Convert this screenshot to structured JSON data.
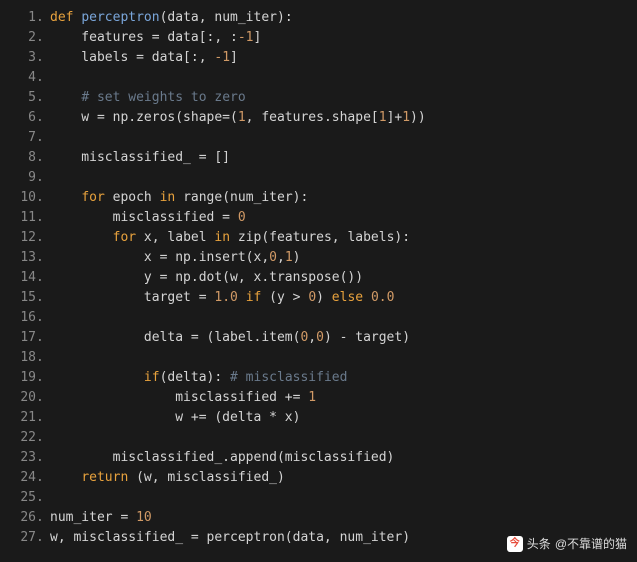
{
  "lines": [
    {
      "n": "1",
      "tokens": [
        [
          "kw",
          "def "
        ],
        [
          "fn",
          "perceptron"
        ],
        [
          "txt",
          "(data, num_iter):"
        ]
      ]
    },
    {
      "n": "2",
      "tokens": [
        [
          "txt",
          "    features = data[:, :"
        ],
        [
          "num",
          "-1"
        ],
        [
          "txt",
          "]"
        ]
      ]
    },
    {
      "n": "3",
      "tokens": [
        [
          "txt",
          "    labels = data[:, "
        ],
        [
          "num",
          "-1"
        ],
        [
          "txt",
          "]"
        ]
      ]
    },
    {
      "n": "4",
      "tokens": []
    },
    {
      "n": "5",
      "tokens": [
        [
          "txt",
          "    "
        ],
        [
          "cm",
          "# set weights to zero"
        ]
      ]
    },
    {
      "n": "6",
      "tokens": [
        [
          "txt",
          "    w = np.zeros(shape=("
        ],
        [
          "num",
          "1"
        ],
        [
          "txt",
          ", features.shape["
        ],
        [
          "num",
          "1"
        ],
        [
          "txt",
          "]+"
        ],
        [
          "num",
          "1"
        ],
        [
          "txt",
          "))"
        ]
      ]
    },
    {
      "n": "7",
      "tokens": []
    },
    {
      "n": "8",
      "tokens": [
        [
          "txt",
          "    misclassified_ = []"
        ]
      ]
    },
    {
      "n": "9",
      "tokens": []
    },
    {
      "n": "10",
      "tokens": [
        [
          "txt",
          "    "
        ],
        [
          "kw",
          "for"
        ],
        [
          "txt",
          " epoch "
        ],
        [
          "kw",
          "in"
        ],
        [
          "txt",
          " range(num_iter):"
        ]
      ]
    },
    {
      "n": "11",
      "tokens": [
        [
          "txt",
          "        misclassified = "
        ],
        [
          "num",
          "0"
        ]
      ]
    },
    {
      "n": "12",
      "tokens": [
        [
          "txt",
          "        "
        ],
        [
          "kw",
          "for"
        ],
        [
          "txt",
          " x, label "
        ],
        [
          "kw",
          "in"
        ],
        [
          "txt",
          " zip(features, labels):"
        ]
      ]
    },
    {
      "n": "13",
      "tokens": [
        [
          "txt",
          "            x = np.insert(x,"
        ],
        [
          "num",
          "0"
        ],
        [
          "txt",
          ","
        ],
        [
          "num",
          "1"
        ],
        [
          "txt",
          ")"
        ]
      ]
    },
    {
      "n": "14",
      "tokens": [
        [
          "txt",
          "            y = np.dot(w, x.transpose())"
        ]
      ]
    },
    {
      "n": "15",
      "tokens": [
        [
          "txt",
          "            target = "
        ],
        [
          "num",
          "1.0"
        ],
        [
          "txt",
          " "
        ],
        [
          "kw",
          "if"
        ],
        [
          "txt",
          " (y > "
        ],
        [
          "num",
          "0"
        ],
        [
          "txt",
          ") "
        ],
        [
          "kw",
          "else"
        ],
        [
          "txt",
          " "
        ],
        [
          "num",
          "0.0"
        ]
      ]
    },
    {
      "n": "16",
      "tokens": []
    },
    {
      "n": "17",
      "tokens": [
        [
          "txt",
          "            delta = (label.item("
        ],
        [
          "num",
          "0"
        ],
        [
          "txt",
          ","
        ],
        [
          "num",
          "0"
        ],
        [
          "txt",
          ") - target)"
        ]
      ]
    },
    {
      "n": "18",
      "tokens": []
    },
    {
      "n": "19",
      "tokens": [
        [
          "txt",
          "            "
        ],
        [
          "kw",
          "if"
        ],
        [
          "txt",
          "(delta): "
        ],
        [
          "cm",
          "# misclassified"
        ]
      ]
    },
    {
      "n": "20",
      "tokens": [
        [
          "txt",
          "                misclassified += "
        ],
        [
          "num",
          "1"
        ]
      ]
    },
    {
      "n": "21",
      "tokens": [
        [
          "txt",
          "                w += (delta * x)"
        ]
      ]
    },
    {
      "n": "22",
      "tokens": []
    },
    {
      "n": "23",
      "tokens": [
        [
          "txt",
          "        misclassified_.append(misclassified)"
        ]
      ]
    },
    {
      "n": "24",
      "tokens": [
        [
          "txt",
          "    "
        ],
        [
          "kw",
          "return"
        ],
        [
          "txt",
          " (w, misclassified_)"
        ]
      ]
    },
    {
      "n": "25",
      "tokens": []
    },
    {
      "n": "26",
      "tokens": [
        [
          "txt",
          "num_iter = "
        ],
        [
          "num",
          "10"
        ]
      ]
    },
    {
      "n": "27",
      "tokens": [
        [
          "txt",
          "w, misclassified_ = perceptron(data, num_iter)"
        ]
      ]
    }
  ],
  "watermark": {
    "label": "头条",
    "handle": "@不靠谱的猫"
  }
}
